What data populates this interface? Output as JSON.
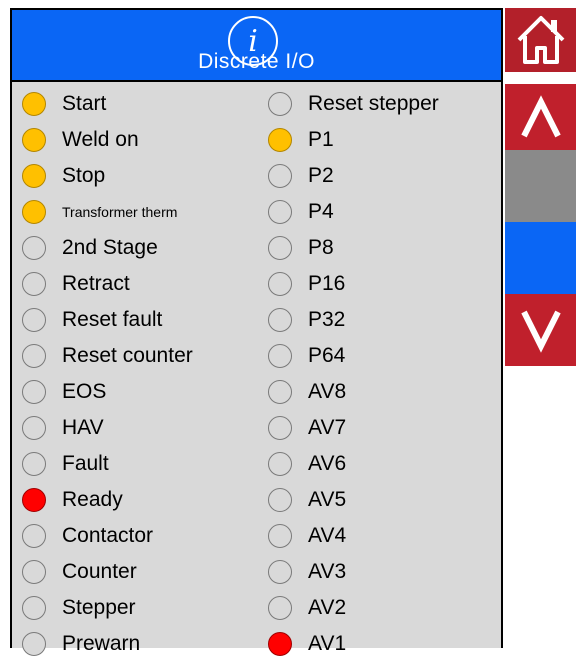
{
  "header": {
    "title": "Discrete I/O",
    "icon": "info-icon"
  },
  "colors": {
    "header": "#0a66f5",
    "panel": "#d9d9d9",
    "led_on_orange": "#ffc000",
    "led_on_red": "#ff0000",
    "nav_red": "#c0202c",
    "nav_gray": "#8a8a8a"
  },
  "left_column": [
    {
      "label": "Start",
      "state": "orange"
    },
    {
      "label": "Weld on",
      "state": "orange"
    },
    {
      "label": "Stop",
      "state": "orange"
    },
    {
      "label": "Transformer therm",
      "state": "orange"
    },
    {
      "label": "2nd Stage",
      "state": "off"
    },
    {
      "label": "Retract",
      "state": "off"
    },
    {
      "label": "Reset fault",
      "state": "off"
    },
    {
      "label": "Reset counter",
      "state": "off"
    },
    {
      "label": "EOS",
      "state": "off"
    },
    {
      "label": "HAV",
      "state": "off"
    },
    {
      "label": "Fault",
      "state": "off"
    },
    {
      "label": "Ready",
      "state": "red"
    },
    {
      "label": "Contactor",
      "state": "off"
    },
    {
      "label": "Counter",
      "state": "off"
    },
    {
      "label": "Stepper",
      "state": "off"
    },
    {
      "label": "Prewarn",
      "state": "off"
    }
  ],
  "right_column": [
    {
      "label": "Reset stepper",
      "state": "off"
    },
    {
      "label": "P1",
      "state": "orange"
    },
    {
      "label": "P2",
      "state": "off"
    },
    {
      "label": "P4",
      "state": "off"
    },
    {
      "label": "P8",
      "state": "off"
    },
    {
      "label": "P16",
      "state": "off"
    },
    {
      "label": "P32",
      "state": "off"
    },
    {
      "label": "P64",
      "state": "off"
    },
    {
      "label": "AV8",
      "state": "off"
    },
    {
      "label": "AV7",
      "state": "off"
    },
    {
      "label": "AV6",
      "state": "off"
    },
    {
      "label": "AV5",
      "state": "off"
    },
    {
      "label": "AV4",
      "state": "off"
    },
    {
      "label": "AV3",
      "state": "off"
    },
    {
      "label": "AV2",
      "state": "off"
    },
    {
      "label": "AV1",
      "state": "red"
    }
  ],
  "nav": {
    "home": "home-icon",
    "up": "chevron-up-icon",
    "down": "chevron-down-icon"
  }
}
